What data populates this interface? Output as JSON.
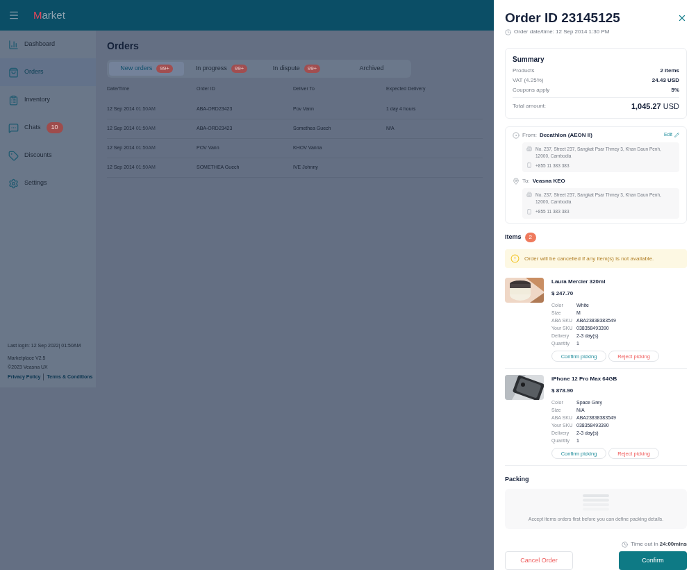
{
  "header": {
    "logo_accent": "M",
    "logo_rest": "arket"
  },
  "sidebar": {
    "items": [
      {
        "label": "Dashboard",
        "selected": false
      },
      {
        "label": "Orders",
        "selected": true
      },
      {
        "label": "Inventory",
        "selected": false
      },
      {
        "label": "Chats",
        "selected": false,
        "badge": "10"
      },
      {
        "label": "Discounts",
        "selected": false
      },
      {
        "label": "Settings",
        "selected": false
      }
    ],
    "last_login": "Last login:  12 Sep 2022| 01:50AM",
    "version": "Marketplace V2.5",
    "copyright": "©2023 Veasna UX",
    "links": [
      "Privacy Policy",
      "Terms & Conditions"
    ]
  },
  "orders": {
    "title": "Orders",
    "tabs": [
      {
        "label": "New orders",
        "count": "99+",
        "selected": true
      },
      {
        "label": "In progress",
        "count": "99+",
        "selected": false
      },
      {
        "label": "In dispute",
        "count": "99+",
        "selected": false
      },
      {
        "label": "Archived",
        "selected": false
      }
    ],
    "columns": [
      "Date/Time",
      "Order ID",
      "Deliver To",
      "Expected Delivery"
    ],
    "rows": [
      {
        "date": "12 Sep 2014",
        "time": "01:50AM",
        "order_id": "ABA-ORD23423",
        "deliver_to": "Pov Vann",
        "expected": "1 day 4 hours"
      },
      {
        "date": "12 Sep 2014",
        "time": "01:50AM",
        "order_id": "ABA-ORD23423",
        "deliver_to": "Somethea Guech",
        "expected": "N/A"
      },
      {
        "date": "12 Sep 2014",
        "time": "01:50AM",
        "order_id": "POV Vann",
        "deliver_to": "KHOV Vanna"
      },
      {
        "date": "12 Sep 2014",
        "time": "01:50AM",
        "order_id": "SOMETHEA Guech",
        "deliver_to": "IVE Johnny"
      }
    ]
  },
  "drawer": {
    "title": "Order ID 23145125",
    "date": "Order date/time: 12 Sep 2014 1:30 PM",
    "summary": {
      "title": "Summary",
      "rows": [
        {
          "label": "Products",
          "value": "2 items"
        },
        {
          "label": "VAT (4.25%)",
          "value": "24.43 USD"
        },
        {
          "label": "Coupons apply",
          "value": "5%"
        }
      ],
      "total_label": "Total amount:",
      "total_value": "1,045.27",
      "total_unit": "USD"
    },
    "route": {
      "from_label": "From:",
      "from_name": "Decathlon (AEON II)",
      "edit": "Edit",
      "from_address": "No. 237, Street 237, Sangkat Psar Thmey 3, Khan Daun Penh, 12000, Cambodia",
      "from_phone": "+855 11 383 383",
      "to_label": "To:",
      "to_name": "Veasna KEO",
      "to_address": "No. 237, Street 237, Sangkat Psar Thmey 3, Khan Daun Penh, 12000, Cambodia",
      "to_phone": "+855 11 383 383"
    },
    "items_title": "Items",
    "items_count": "2",
    "warning": "Order will be cancelled if any item(s) is not available.",
    "items": [
      {
        "name": "Laura Mercier 320ml",
        "price": "$ 247.70",
        "details": [
          {
            "label": "Color",
            "value": "White"
          },
          {
            "label": "Size",
            "value": "M"
          },
          {
            "label": "ABA SKU",
            "value": "ABA23838383549"
          },
          {
            "label": "Your SKU",
            "value": "038358493390"
          },
          {
            "label": "Delivery",
            "value": "2-3 day(s)"
          },
          {
            "label": "Quantity",
            "value": "1"
          }
        ],
        "confirm": "Confirm picking",
        "reject": "Reject picking"
      },
      {
        "name": "iPhone 12 Pro Max 64GB",
        "price": "$ 878.90",
        "details": [
          {
            "label": "Color",
            "value": "Space Grey"
          },
          {
            "label": "Size",
            "value": "N/A"
          },
          {
            "label": "ABA SKU",
            "value": "ABA23838383549"
          },
          {
            "label": "Your SKU",
            "value": "038358493390"
          },
          {
            "label": "Delivery",
            "value": "2-3 day(s)"
          },
          {
            "label": "Quantity",
            "value": "1"
          }
        ],
        "confirm": "Confirm picking",
        "reject": "Reject picking"
      }
    ],
    "packing_title": "Packing",
    "packing_hint": "Accept items orders first before you can define packing details.",
    "timeout_label": "Time out in",
    "timeout_value": "24:00mins",
    "cancel": "Cancel Order",
    "confirm": "Confirm"
  }
}
